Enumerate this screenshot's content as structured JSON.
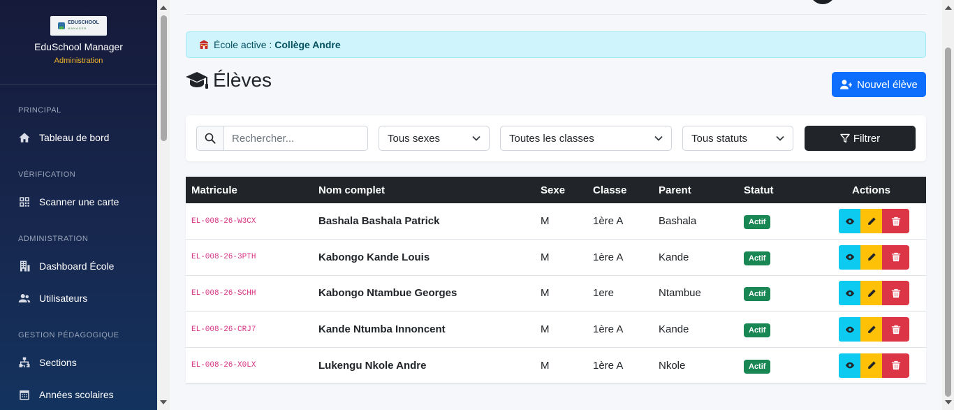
{
  "sidebar": {
    "brand_name": "EduSchool Manager",
    "brand_sub": "Administration",
    "logo_text": "EDUSCHOOL",
    "logo_sub": "MANAGER",
    "sections": [
      {
        "title": "PRINCIPAL",
        "items": [
          {
            "label": "Tableau de bord",
            "icon": "home-icon"
          }
        ]
      },
      {
        "title": "VÉRIFICATION",
        "items": [
          {
            "label": "Scanner une carte",
            "icon": "qrcode-icon"
          }
        ]
      },
      {
        "title": "ADMINISTRATION",
        "items": [
          {
            "label": "Dashboard École",
            "icon": "building-icon"
          },
          {
            "label": "Utilisateurs",
            "icon": "users-icon"
          }
        ]
      },
      {
        "title": "GESTION PÉDAGOGIQUE",
        "items": [
          {
            "label": "Sections",
            "icon": "sitemap-icon"
          },
          {
            "label": "Années scolaires",
            "icon": "calendar-icon"
          }
        ]
      }
    ]
  },
  "alert": {
    "prefix": "École active :",
    "school": "Collège Andre"
  },
  "page": {
    "title": "Élèves",
    "new_button": "Nouvel élève"
  },
  "filters": {
    "search_placeholder": "Rechercher...",
    "sex": "Tous sexes",
    "class": "Toutes les classes",
    "status": "Tous statuts",
    "filter_button": "Filtrer"
  },
  "table": {
    "headers": [
      "Matricule",
      "Nom complet",
      "Sexe",
      "Classe",
      "Parent",
      "Statut",
      "Actions"
    ],
    "rows": [
      {
        "matricule": "EL-008-26-W3CX",
        "name": "Bashala Bashala Patrick",
        "sex": "M",
        "class": "1ère A",
        "parent": "Bashala",
        "status": "Actif"
      },
      {
        "matricule": "EL-008-26-3PTH",
        "name": "Kabongo Kande Louis",
        "sex": "M",
        "class": "1ère A",
        "parent": "Kande",
        "status": "Actif"
      },
      {
        "matricule": "EL-008-26-SCHH",
        "name": "Kabongo Ntambue Georges",
        "sex": "M",
        "class": "1ere",
        "parent": "Ntambue",
        "status": "Actif"
      },
      {
        "matricule": "EL-008-26-CRJ7",
        "name": "Kande Ntumba Innoncent",
        "sex": "M",
        "class": "1ère A",
        "parent": "Kande",
        "status": "Actif"
      },
      {
        "matricule": "EL-008-26-X0LX",
        "name": "Lukengu Nkole Andre",
        "sex": "M",
        "class": "1ère A",
        "parent": "Nkole",
        "status": "Actif"
      }
    ]
  },
  "colors": {
    "primary": "#0d6efd",
    "dark": "#212529",
    "success": "#198754",
    "info": "#0dcaf0",
    "warning": "#ffc107",
    "danger": "#dc3545",
    "sidebar_accent": "#f0b429"
  }
}
